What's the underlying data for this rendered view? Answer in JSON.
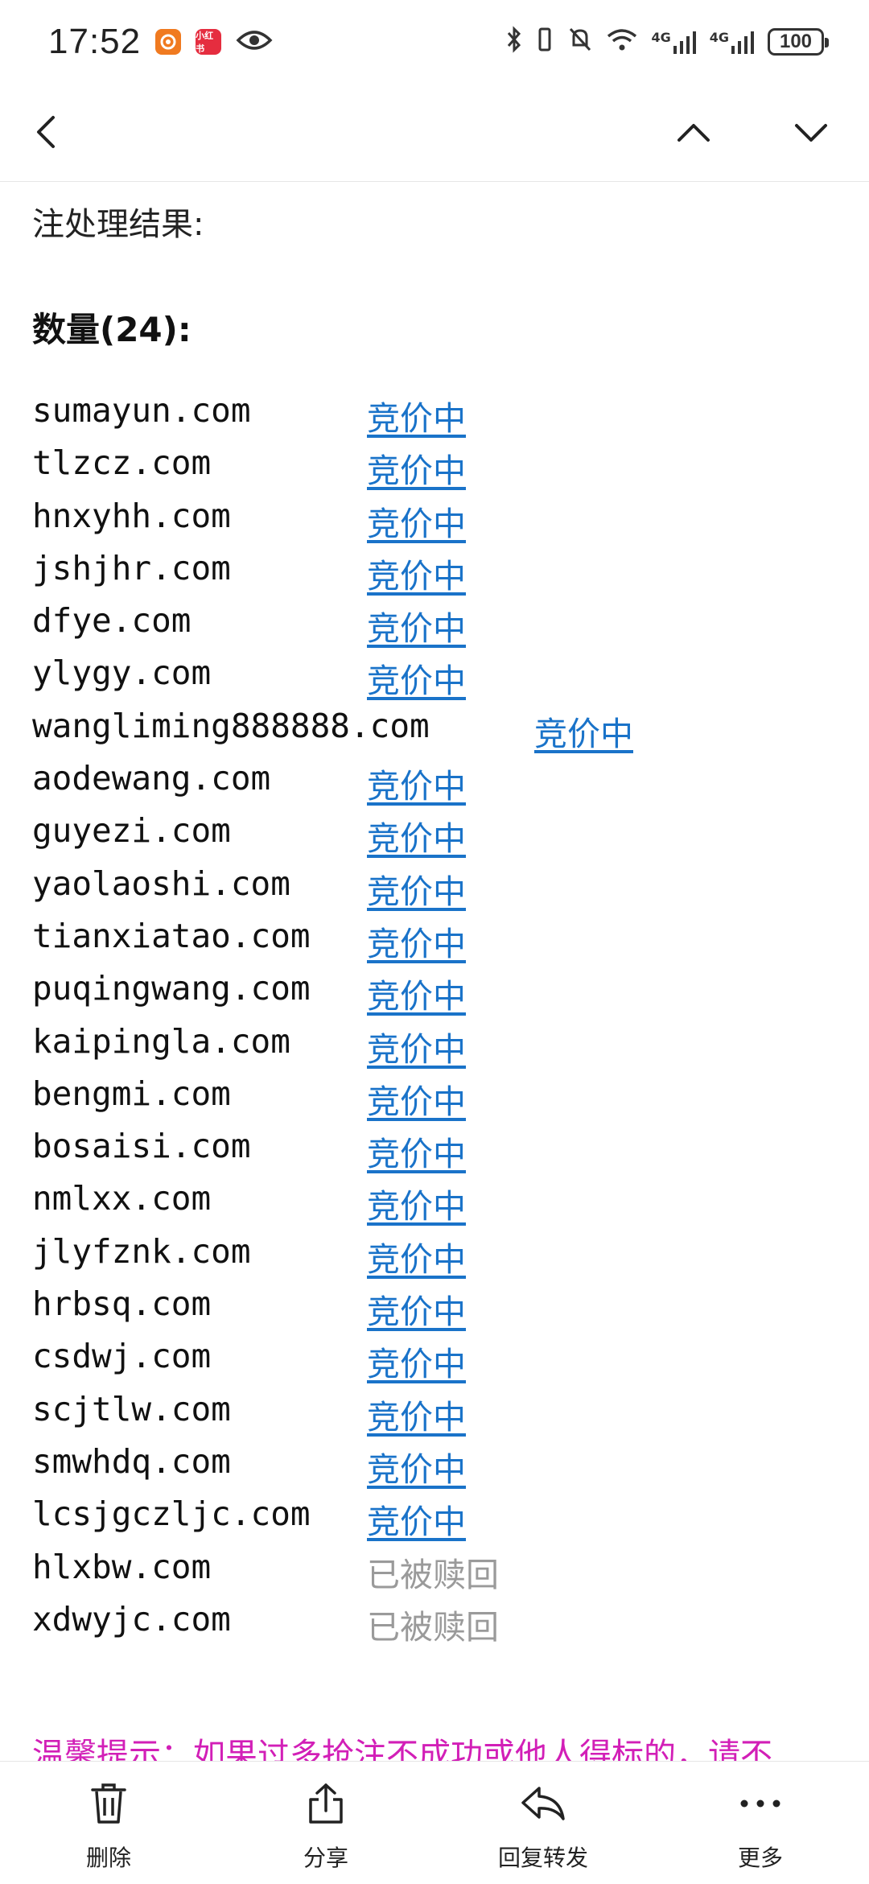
{
  "status_bar": {
    "time": "17:52",
    "notif_app2_label": "小红书",
    "battery": "100",
    "signal_label_1": "4G",
    "signal_label_2": "4G"
  },
  "content": {
    "result_label": "注处理结果:",
    "count_heading": "数量(24):",
    "domains": [
      {
        "name": "sumayun.com",
        "status": "竞价中",
        "kind": "link"
      },
      {
        "name": "tlzcz.com",
        "status": "竞价中",
        "kind": "link"
      },
      {
        "name": "hnxyhh.com",
        "status": "竞价中",
        "kind": "link"
      },
      {
        "name": "jshjhr.com",
        "status": "竞价中",
        "kind": "link"
      },
      {
        "name": "dfye.com",
        "status": "竞价中",
        "kind": "link"
      },
      {
        "name": "ylygy.com",
        "status": "竞价中",
        "kind": "link"
      },
      {
        "name": "wangliming888888.com",
        "status": "竞价中",
        "kind": "link"
      },
      {
        "name": "aodewang.com",
        "status": "竞价中",
        "kind": "link"
      },
      {
        "name": "guyezi.com",
        "status": "竞价中",
        "kind": "link"
      },
      {
        "name": "yaolaoshi.com",
        "status": "竞价中",
        "kind": "link"
      },
      {
        "name": "tianxiatao.com",
        "status": "竞价中",
        "kind": "link"
      },
      {
        "name": "puqingwang.com",
        "status": "竞价中",
        "kind": "link"
      },
      {
        "name": "kaipingla.com",
        "status": "竞价中",
        "kind": "link"
      },
      {
        "name": "bengmi.com",
        "status": "竞价中",
        "kind": "link"
      },
      {
        "name": "bosaisi.com",
        "status": "竞价中",
        "kind": "link"
      },
      {
        "name": "nmlxx.com",
        "status": "竞价中",
        "kind": "link"
      },
      {
        "name": "jlyfznk.com",
        "status": "竞价中",
        "kind": "link"
      },
      {
        "name": "hrbsq.com",
        "status": "竞价中",
        "kind": "link"
      },
      {
        "name": "csdwj.com",
        "status": "竞价中",
        "kind": "link"
      },
      {
        "name": "scjtlw.com",
        "status": "竞价中",
        "kind": "link"
      },
      {
        "name": "smwhdq.com",
        "status": "竞价中",
        "kind": "link"
      },
      {
        "name": "lcsjgczljc.com",
        "status": "竞价中",
        "kind": "link"
      },
      {
        "name": "hlxbw.com",
        "status": "已被赎回",
        "kind": "grey"
      },
      {
        "name": "xdwyjc.com",
        "status": "已被赎回",
        "kind": "grey"
      }
    ],
    "tip_text": "温馨提示：如果过多抢注不成功或他人得标的，请不"
  },
  "toolbar": {
    "delete": "删除",
    "share": "分享",
    "reply_forward": "回复转发",
    "more": "更多"
  },
  "colors": {
    "link": "#1a73c9",
    "redeemed": "#9a9a9a",
    "tip": "#d21fb7"
  },
  "icons": {
    "back": "chevron-left-icon",
    "prev": "chevron-up-icon",
    "next": "chevron-down-icon",
    "delete": "trash-icon",
    "share": "share-icon",
    "reply": "reply-icon",
    "more": "more-dots-icon"
  }
}
